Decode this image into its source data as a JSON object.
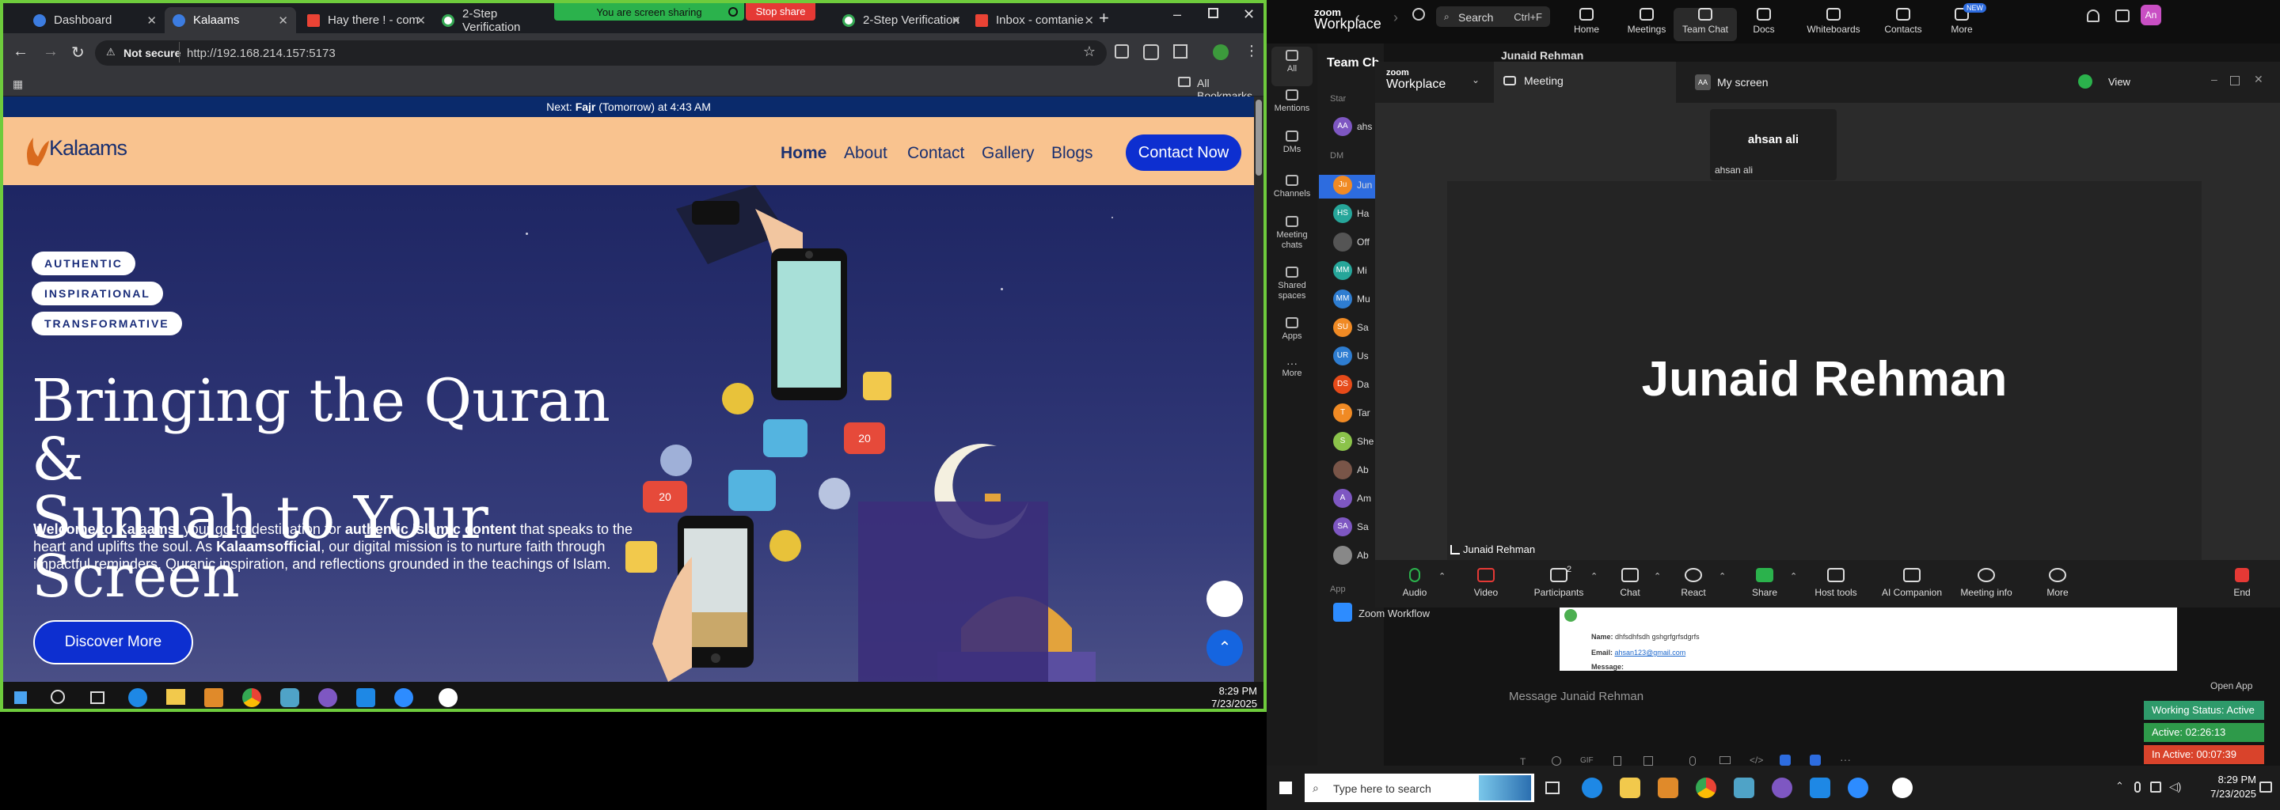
{
  "browser": {
    "tabs": [
      {
        "title": "Dashboard",
        "color": "#3c7ce0"
      },
      {
        "title": "Kalaams",
        "color": "#3c7ce0"
      },
      {
        "title": "Hay there ! - com",
        "color": "#ea4335"
      },
      {
        "title": "2-Step Verification",
        "color": "#34a853"
      },
      {
        "title": "2-Step Verification",
        "color": "#34a853"
      },
      {
        "title": "Inbox - comtanie",
        "color": "#ea4335"
      }
    ],
    "share_banner": {
      "text": "You are screen sharing",
      "stop_label": "Stop share"
    },
    "security_label": "Not secure",
    "url": "http://192.168.214.157:5173",
    "bookmarks_label": "All Bookmarks"
  },
  "site": {
    "prayer_prefix": "Next:",
    "prayer_name": "Fajr",
    "prayer_suffix": "(Tomorrow) at 4:43 AM",
    "logo_text": "Kalaams",
    "nav": [
      "Home",
      "About",
      "Contact",
      "Gallery",
      "Blogs"
    ],
    "cta_label": "Contact Now",
    "pills": [
      "AUTHENTIC",
      "INSPIRATIONAL",
      "TRANSFORMATIVE"
    ],
    "headline_line1": "Bringing the Quran &",
    "headline_line2": "Sunnah to Your Screen",
    "blurb": {
      "p1": "Welcome to Kalaams",
      "p2": ", your go-to destination for ",
      "p3": "authentic Islamic content",
      "p4": " that speaks to the heart and uplifts the soul. As ",
      "p5": "Kalaamsofficial",
      "p6": ", our digital mission is to nurture faith through impactful reminders, Quranic inspiration, and reflections grounded in the teachings of Islam."
    },
    "discover_label": "Discover More",
    "social_counts": [
      "20",
      "20"
    ]
  },
  "taskbar_left": {
    "time": "8:29 PM",
    "date": "7/23/2025"
  },
  "zoom": {
    "app_name_top": "zoom",
    "app_name_bottom": "Workplace",
    "search_label": "Search",
    "search_shortcut": "Ctrl+F",
    "top_nav": [
      "Home",
      "Meetings",
      "Team Chat",
      "Docs",
      "Whiteboards",
      "Contacts",
      "More"
    ],
    "new_badge": "NEW",
    "user_initials": "An",
    "side_nav": [
      "All",
      "Mentions",
      "DMs",
      "Channels",
      "Meeting chats",
      "Shared spaces",
      "Apps",
      "More"
    ],
    "team_chat_label": "Team Ch",
    "chat_header": "Junaid Rehman",
    "contacts": [
      {
        "initials": "AA",
        "name": "ahs",
        "color": "#7e57c2"
      },
      {
        "initials": "Ju",
        "name": "Jun",
        "color": "#f08a24"
      },
      {
        "initials": "HS",
        "name": "Ha",
        "color": "#26a69a"
      },
      {
        "initials": "",
        "name": "Off",
        "color": "#555555"
      },
      {
        "initials": "MM",
        "name": "Mi",
        "color": "#26a69a"
      },
      {
        "initials": "MM",
        "name": "Mu",
        "color": "#2e7dd1"
      },
      {
        "initials": "SU",
        "name": "Sa",
        "color": "#f08a24"
      },
      {
        "initials": "UR",
        "name": "Us",
        "color": "#2e7dd1"
      },
      {
        "initials": "DS",
        "name": "Da",
        "color": "#e64a19"
      },
      {
        "initials": "T",
        "name": "Tar",
        "color": "#f08a24"
      },
      {
        "initials": "S",
        "name": "She",
        "color": "#8bc34a"
      },
      {
        "initials": "",
        "name": "Ab",
        "color": "#795548"
      },
      {
        "initials": "A",
        "name": "Am",
        "color": "#7e57c2"
      },
      {
        "initials": "SA",
        "name": "Sa",
        "color": "#7e57c2"
      },
      {
        "initials": "",
        "name": "Ab",
        "color": "#888888"
      }
    ],
    "section_starred": "Star",
    "section_dms": "DM",
    "section_apps": "App",
    "zoom_workflow_label": "Zoom Workflow",
    "meeting": {
      "title_top": "zoom",
      "title_bottom": "Workplace",
      "tab_meeting": "Meeting",
      "tab_myscreen": "My screen",
      "myscreen_initials": "AA",
      "view_label": "View",
      "participant_thumb": "ahsan ali",
      "participant_thumb_label": "ahsan ali",
      "speaker_name": "Junaid Rehman",
      "speaker_label": "Junaid Rehman",
      "participants_count": "2",
      "controls": [
        "Audio",
        "Video",
        "Participants",
        "Chat",
        "React",
        "Share",
        "Host tools",
        "AI Companion",
        "Meeting info",
        "More",
        "End"
      ]
    },
    "email_preview": {
      "name_label": "Name:",
      "name_value": "dhfsdhfsdh gshgrfgrfsdgrfs",
      "email_label": "Email:",
      "email_value": "ahsan123@gmail.com",
      "message_label": "Message:"
    },
    "open_app_label": "Open App",
    "message_placeholder": "Message Junaid Rehman",
    "status": {
      "working": "Working Status: Active",
      "active": "Active: 02:26:13",
      "inactive": "In Active: 00:07:39"
    }
  },
  "taskbar_right": {
    "search_placeholder": "Type here to search",
    "time": "8:29 PM",
    "date": "7/23/2025"
  }
}
